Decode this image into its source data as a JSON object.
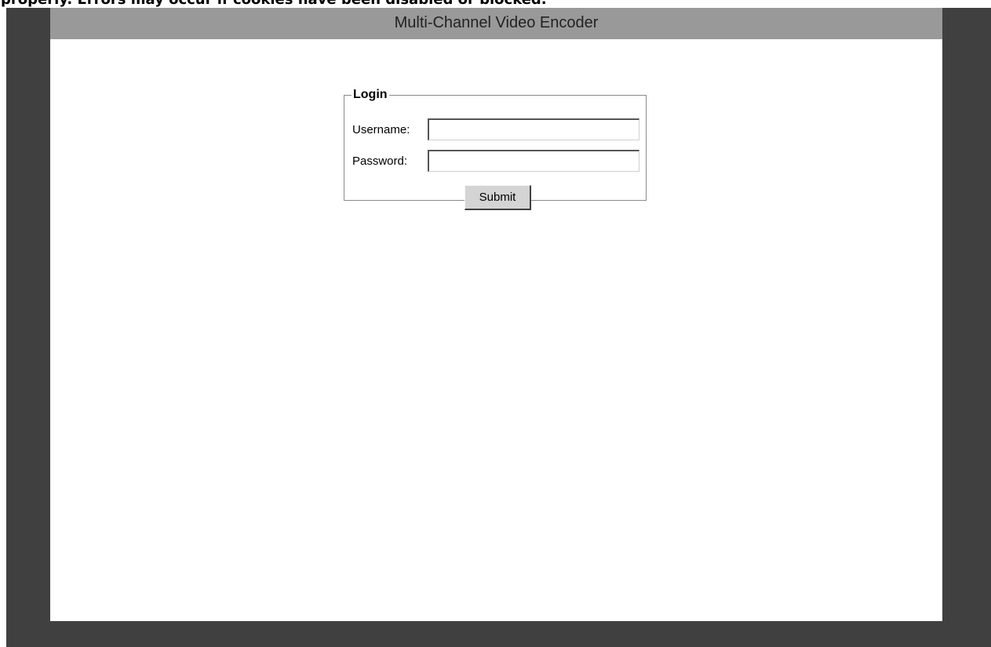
{
  "warning_text": "properly. Errors may occur if cookies have been disabled or blocked.",
  "header": {
    "title": "Multi-Channel Video Encoder"
  },
  "login": {
    "legend": "Login",
    "username_label": "Username:",
    "username_value": "",
    "password_label": "Password:",
    "password_value": "",
    "submit_label": "Submit"
  },
  "colors": {
    "frame": "#404040",
    "header_bar": "#999999",
    "panel": "#ffffff",
    "button_face": "#d4d4d4"
  }
}
